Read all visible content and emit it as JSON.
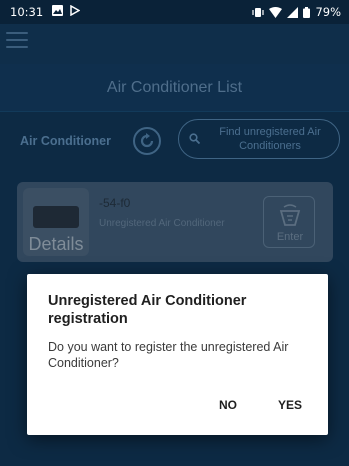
{
  "status_bar": {
    "time": "10:31",
    "battery": "79%",
    "icons": [
      "gallery-icon",
      "play-icon",
      "vibrate-icon",
      "wifi-icon",
      "signal-icon",
      "battery-icon"
    ]
  },
  "header": {
    "title": "Air Conditioner List"
  },
  "toolbar": {
    "section_label": "Air Conditioner",
    "find_button_label": "Find unregistered Air Conditioners"
  },
  "device": {
    "name": "-54-f0",
    "status": "Unregistered Air Conditioner",
    "details_label": "Details",
    "enter_label": "Enter"
  },
  "dialog": {
    "title": "Unregistered Air Conditioner registration",
    "message": "Do you want to register the unregistered Air Conditioner?",
    "no_label": "NO",
    "yes_label": "YES"
  },
  "colors": {
    "background": "#0d2a44",
    "dialog_bg": "#ffffff",
    "dim_text": "#4b6f8f"
  }
}
